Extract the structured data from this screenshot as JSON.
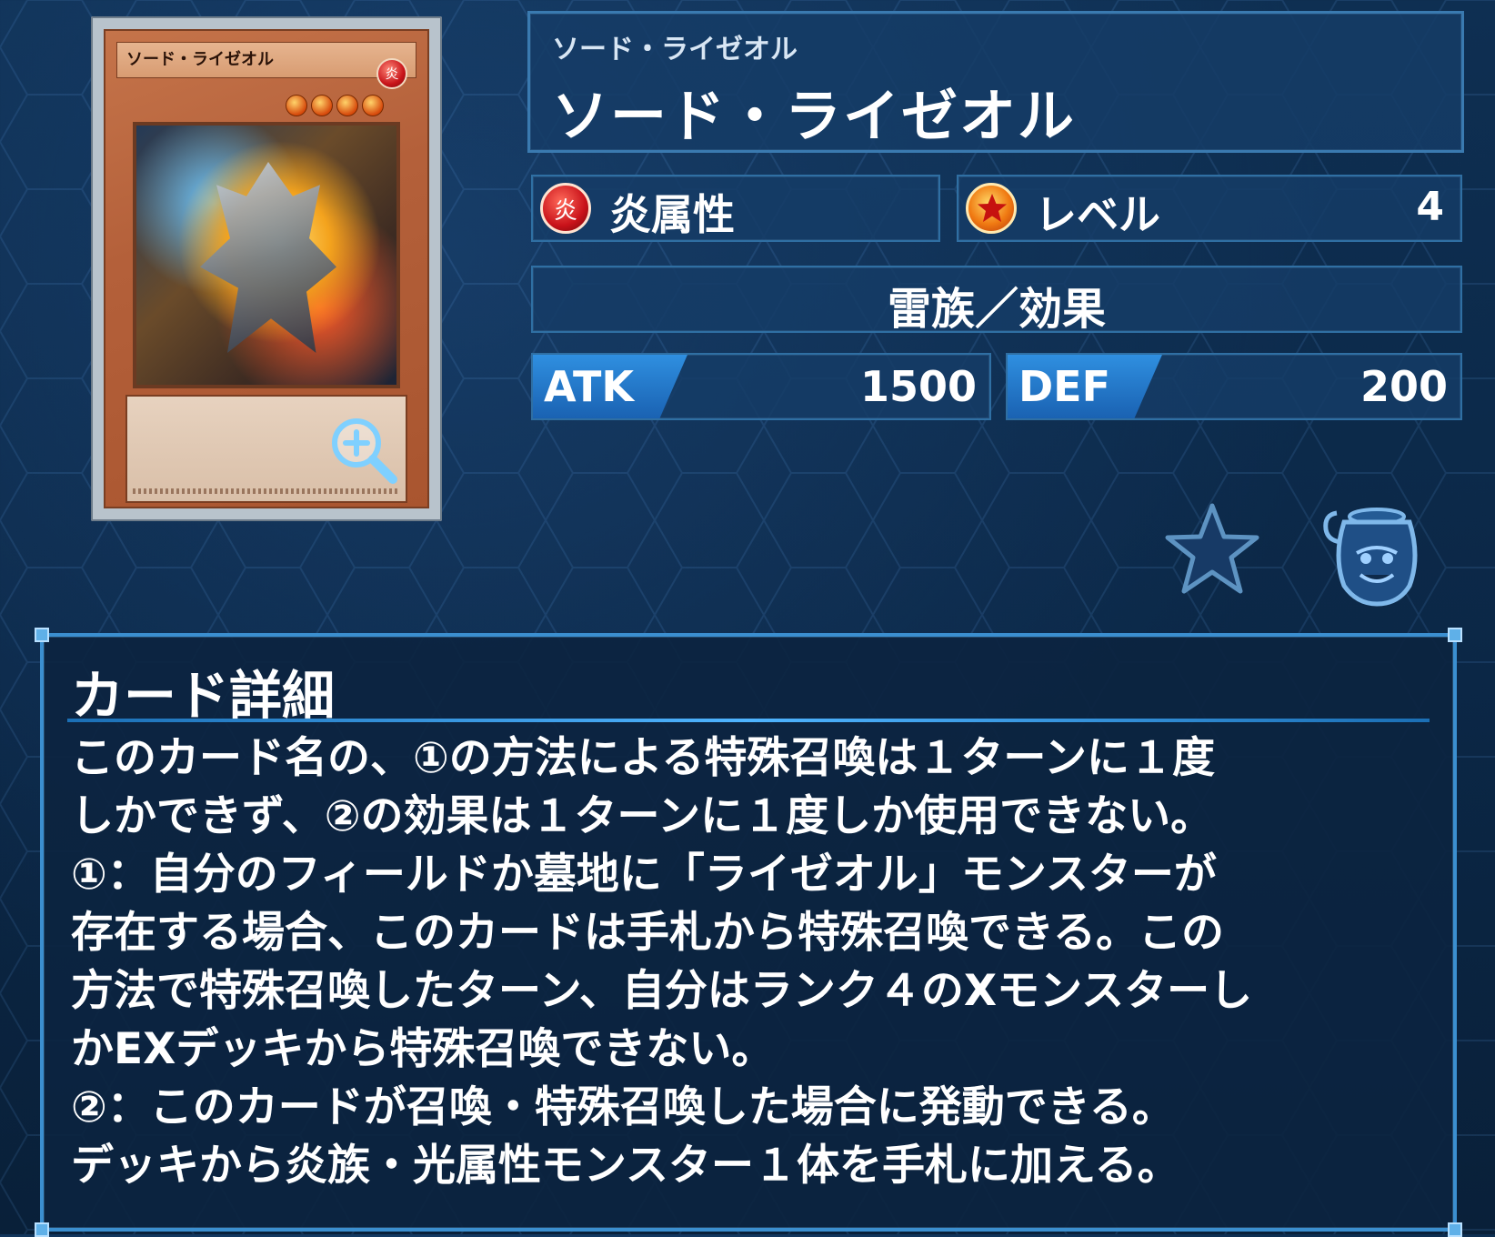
{
  "card_image": {
    "name_text": "ソード・ライゼオル",
    "attribute_glyph": "炎"
  },
  "card": {
    "ruby": "ソード・ライゼオル",
    "name": "ソード・ライゼオル",
    "attribute_glyph": "炎",
    "attribute": "炎属性",
    "level_label": "レベル",
    "level_value": "4",
    "type": "雷族／効果",
    "atk_label": "ATK",
    "atk": "1500",
    "def_label": "DEF",
    "def": "200"
  },
  "detail": {
    "title": "カード詳細",
    "lines": [
      "このカード名の、①の方法による特殊召喚は１ターンに１度",
      "しかできず、②の効果は１ターンに１度しか使用できない。",
      "①：自分のフィールドか墓地に「ライゼオル」モンスターが",
      "存在する場合、このカードは手札から特殊召喚できる。この",
      "方法で特殊召喚したターン、自分はランク４のXモンスターし",
      "かEXデッキから特殊召喚できない。",
      "②：このカードが召喚・特殊召喚した場合に発動できる。",
      "デッキから炎族・光属性モンスター１体を手札に加える。"
    ]
  },
  "icons": {
    "zoom": "zoom-in-icon",
    "favorite": "star-icon",
    "pot": "pot-of-greed-icon"
  },
  "colors": {
    "background": "#0b2746",
    "panel": "#153c66",
    "accent": "#3b8fd0",
    "stat_tag": "#2f8fe0",
    "fire": "#c9121a"
  }
}
